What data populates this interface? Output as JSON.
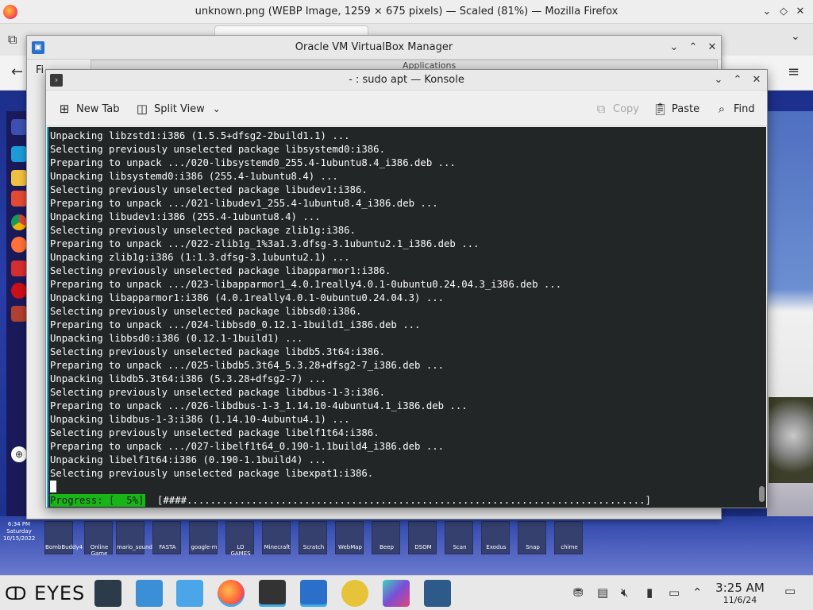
{
  "firefox": {
    "title": "unknown.png (WEBP Image, 1259 × 675 pixels) — Scaled (81%) — Mozilla Firefox"
  },
  "vbox": {
    "title": "Oracle VM VirtualBox Manager",
    "file_menu": "Fi",
    "applications_label": "Applications"
  },
  "konsole": {
    "title": "- : sudo apt — Konsole",
    "toolbar": {
      "new_tab": "New Tab",
      "split_view": "Split View",
      "copy": "Copy",
      "paste": "Paste",
      "find": "Find"
    },
    "terminal_lines": [
      "Unpacking libzstd1:i386 (1.5.5+dfsg2-2build1.1) ...",
      "Selecting previously unselected package libsystemd0:i386.",
      "Preparing to unpack .../020-libsystemd0_255.4-1ubuntu8.4_i386.deb ...",
      "Unpacking libsystemd0:i386 (255.4-1ubuntu8.4) ...",
      "Selecting previously unselected package libudev1:i386.",
      "Preparing to unpack .../021-libudev1_255.4-1ubuntu8.4_i386.deb ...",
      "Unpacking libudev1:i386 (255.4-1ubuntu8.4) ...",
      "Selecting previously unselected package zlib1g:i386.",
      "Preparing to unpack .../022-zlib1g_1%3a1.3.dfsg-3.1ubuntu2.1_i386.deb ...",
      "Unpacking zlib1g:i386 (1:1.3.dfsg-3.1ubuntu2.1) ...",
      "Selecting previously unselected package libapparmor1:i386.",
      "Preparing to unpack .../023-libapparmor1_4.0.1really4.0.1-0ubuntu0.24.04.3_i386.deb ...",
      "Unpacking libapparmor1:i386 (4.0.1really4.0.1-0ubuntu0.24.04.3) ...",
      "Selecting previously unselected package libbsd0:i386.",
      "Preparing to unpack .../024-libbsd0_0.12.1-1build1_i386.deb ...",
      "Unpacking libbsd0:i386 (0.12.1-1build1) ...",
      "Selecting previously unselected package libdb5.3t64:i386.",
      "Preparing to unpack .../025-libdb5.3t64_5.3.28+dfsg2-7_i386.deb ...",
      "Unpacking libdb5.3t64:i386 (5.3.28+dfsg2-7) ...",
      "Selecting previously unselected package libdbus-1-3:i386.",
      "Preparing to unpack .../026-libdbus-1-3_1.14.10-4ubuntu4.1_i386.deb ...",
      "Unpacking libdbus-1-3:i386 (1.14.10-4ubuntu4.1) ...",
      "Selecting previously unselected package libelf1t64:i386.",
      "Preparing to unpack .../027-libelf1t64_0.190-1.1build4_i386.deb ...",
      "Unpacking libelf1t64:i386 (0.190-1.1build4) ...",
      "Selecting previously unselected package libexpat1:i386."
    ],
    "progress_label": "Progress: [  5%]",
    "progress_percent": 5,
    "progress_bar": "[####..............................................................................]"
  },
  "desktop": {
    "mini_clock": "6:34 PM\nSaturday\n10/15/2022",
    "tile_labels": [
      "BombBuddy4",
      "Online Game",
      "mario_sounds",
      "FASTA",
      "google-m",
      "LO GAMES",
      "Minecraft",
      "Scratch",
      "WebMap",
      "Beep",
      "DSOM",
      "Scan",
      "Exodus",
      "Snap",
      "chime"
    ]
  },
  "taskbar": {
    "launcher_label": "EYES",
    "time": "3:25 AM",
    "date": "11/6/24"
  },
  "colors": {
    "terminal_bg": "#232627",
    "terminal_fg": "#fcfcfc",
    "progress_green": "#17b517",
    "accent_blue": "#3daee9"
  }
}
